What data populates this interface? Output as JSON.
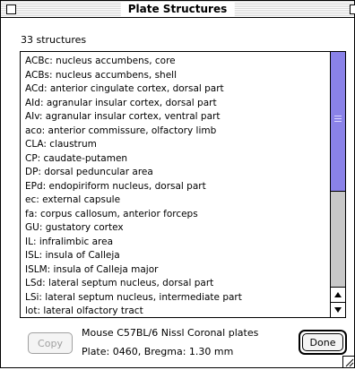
{
  "window": {
    "title": "Plate Structures"
  },
  "summary": {
    "count_text": "33 structures"
  },
  "structures": [
    "ACBc: nucleus accumbens, core",
    "ACBs: nucleus accumbens, shell",
    "ACd: anterior cingulate cortex, dorsal part",
    "AId: agranular insular cortex, dorsal part",
    "AIv: agranular insular cortex, ventral part",
    "aco: anterior commissure, olfactory limb",
    "CLA: claustrum",
    "CP: caudate-putamen",
    "DP: dorsal peduncular area",
    "EPd: endopiriform nucleus, dorsal part",
    "ec: external capsule",
    "fa: corpus callosum, anterior forceps",
    "GU: gustatory cortex",
    "IL: infralimbic area",
    "ISL: insula of Calleja",
    "ISLM: insula of Calleja major",
    "LSd: lateral septum nucleus, dorsal part",
    "LSi: lateral septum nucleus, intermediate part",
    "lot: lateral olfactory tract"
  ],
  "scrollbar": {
    "thumb_color": "#8a82e8",
    "track_color": "#c8c8c8"
  },
  "footer": {
    "copy_label": "Copy",
    "plate_name": "Mouse C57BL/6 Nissl Coronal plates",
    "plate_info": "Plate: 0460, Bregma: 1.30 mm",
    "done_label": "Done"
  },
  "icons": {
    "close": "close-box-icon",
    "zoom": "zoom-box-icon",
    "up": "up-arrow-icon",
    "down": "down-arrow-icon",
    "grow": "resize-grip-icon"
  }
}
